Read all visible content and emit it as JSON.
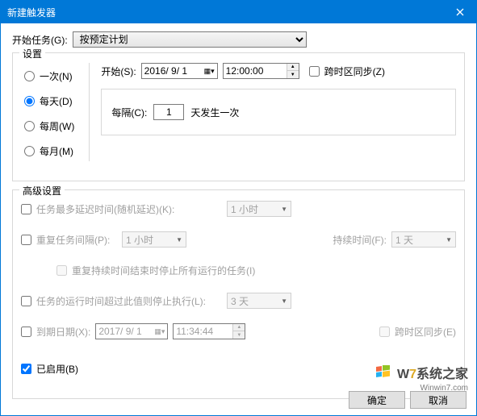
{
  "titlebar": {
    "title": "新建触发器"
  },
  "begin": {
    "label": "开始任务(G):",
    "value": "按预定计划"
  },
  "schedule": {
    "legend": "设置",
    "radios": {
      "once": "一次(N)",
      "daily": "每天(D)",
      "weekly": "每周(W)",
      "monthly": "每月(M)"
    },
    "selected": "daily",
    "start_label": "开始(S):",
    "start_date": "2016/ 9/ 1",
    "start_time": "12:00:00",
    "sync_label": "跨时区同步(Z)",
    "recur_label": "每隔(C):",
    "recur_value": "1",
    "recur_suffix": "天发生一次"
  },
  "advanced": {
    "legend": "高级设置",
    "delay_label": "任务最多延迟时间(随机延迟)(K):",
    "delay_value": "1 小时",
    "repeat_label": "重复任务间隔(P):",
    "repeat_value": "1 小时",
    "duration_label": "持续时间(F):",
    "duration_value": "1 天",
    "stop_after_repeat": "重复持续时间结束时停止所有运行的任务(I)",
    "stop_if_label": "任务的运行时间超过此值则停止执行(L):",
    "stop_if_value": "3 天",
    "expire_label": "到期日期(X):",
    "expire_date": "2017/ 9/ 1",
    "expire_time": "11:34:44",
    "expire_sync": "跨时区同步(E)",
    "enabled_label": "已启用(B)"
  },
  "buttons": {
    "ok": "确定",
    "cancel": "取消"
  },
  "watermark": {
    "brand_w": "W",
    "brand_num": "7",
    "brand_tail": "系统之家",
    "url": "Winwin7.com"
  }
}
